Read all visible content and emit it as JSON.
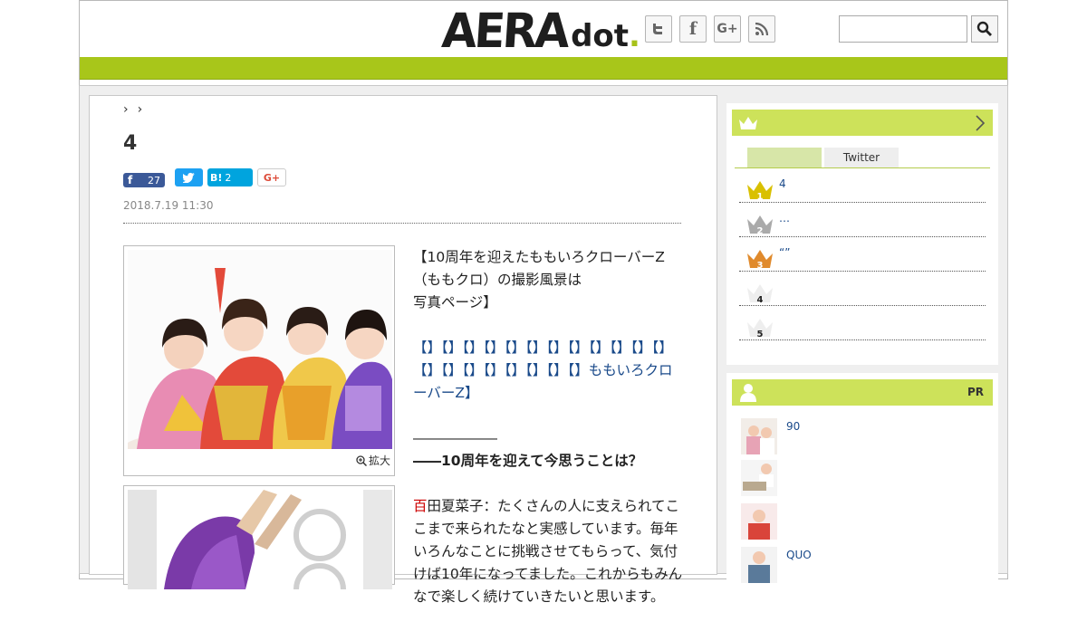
{
  "header": {
    "logo_main": "AERA",
    "logo_sub": "dot",
    "logo_period": ".",
    "social": {
      "twitter_icon": "twitter-icon",
      "facebook_icon": "facebook-icon",
      "googleplus_icon": "googleplus-icon",
      "rss_icon": "rss-icon",
      "facebook_glyph": "f",
      "googleplus_glyph": "G+"
    },
    "search": {
      "value": "",
      "icon": "search-icon"
    }
  },
  "colors": {
    "accent_green": "#a8c61a",
    "sidebar_head_green": "#cde25a",
    "link_blue": "#1a4a8a",
    "gold": "#d9c000",
    "silver": "#aaaaaa",
    "bronze": "#e08a2c"
  },
  "article": {
    "breadcrumb_sep_1": "›",
    "breadcrumb_sep_2": "›",
    "title": "4",
    "share": {
      "facebook_count": "27",
      "hatena_label": "B!",
      "hatena_count": "2",
      "googleplus_label": "G+"
    },
    "date": "2018.7.19 11:30",
    "zoom_label": "拡大",
    "paragraphs": {
      "p1": "【10周年を迎えたももいろクローバーZ（ももクロ）の撮影風景は",
      "p1b": "写真ページ】",
      "p2_link": "【】【】【】【】【】【】【】【】【】【】【】【】【】【】【】【】【】【】【】【】ももいろクローバーZ】",
      "p3_line1": "――――――",
      "p3_line2": "――10周年を迎えて今思うことは？",
      "p4_mark": "百",
      "p4": "田夏菜子：たくさんの人に支えられてここまで来られたなと実感しています。毎年いろんなことに挑戦させてもらって、気付けば10年になってました。これからもみんなで楽しく続けていきたいと思います。"
    }
  },
  "sidebar": {
    "ranking": {
      "crown_icon": "crown-icon",
      "arrow": "›",
      "tab_active": "",
      "tab_twitter": "Twitter",
      "items": [
        {
          "rank": "1",
          "text": "4"
        },
        {
          "rank": "2",
          "text": "…"
        },
        {
          "rank": "3",
          "text": "“”"
        },
        {
          "rank": "4",
          "text": ""
        },
        {
          "rank": "5",
          "text": ""
        }
      ]
    },
    "pr": {
      "person_icon": "person-icon",
      "label": "PR",
      "items": [
        {
          "text": "90"
        },
        {
          "text": ""
        },
        {
          "text": ""
        },
        {
          "text": "QUO"
        }
      ]
    }
  }
}
